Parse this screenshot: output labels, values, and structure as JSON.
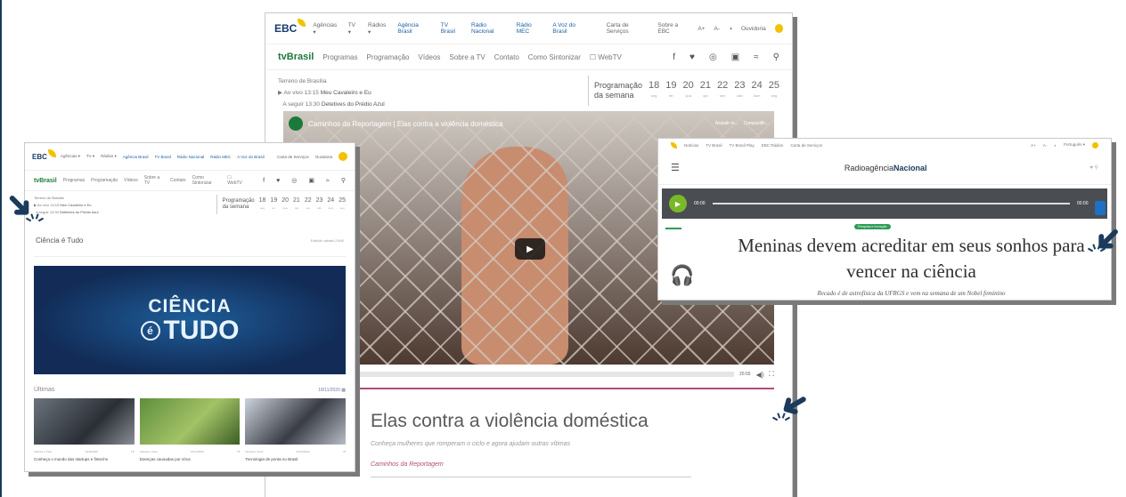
{
  "center": {
    "ebc": {
      "logo": "EBC",
      "links": [
        "Agências ▾",
        "TV ▾",
        "Rádios ▾"
      ],
      "brands": [
        "Agência Brasil",
        "TV Brasil",
        "Rádio Nacional",
        "Rádio MEC",
        "A Voz do Brasil"
      ],
      "right_links": [
        "Carta de Serviços",
        "Sobre a EBC",
        "A+",
        "A-",
        "◑",
        "Ouvidoria"
      ]
    },
    "tvbrasil": {
      "logo": "tvBrasil",
      "nav": [
        "Programas",
        "Programação",
        "Vídeos",
        "Sobre a TV",
        "Contato",
        "Como Sintonizar",
        "☐ WebTV"
      ],
      "social": [
        "f",
        "♥",
        "◎",
        "▣",
        "≈",
        "⚲"
      ]
    },
    "schedule": {
      "region": "Terreno de Brasília",
      "live_label": "Ao vivo",
      "live_time": "13:15",
      "live_show": "Meu Cavaleiro e Eu",
      "next_label": "A seguir",
      "next_time": "13:30",
      "next_show": "Detetives do Prédio Azul",
      "week_label_1": "Programação",
      "week_label_2": "da semana",
      "days": [
        {
          "n": "18",
          "d": "seg"
        },
        {
          "n": "19",
          "d": "ter"
        },
        {
          "n": "20",
          "d": "qua"
        },
        {
          "n": "21",
          "d": "qui"
        },
        {
          "n": "22",
          "d": "sex"
        },
        {
          "n": "23",
          "d": "sáb"
        },
        {
          "n": "24",
          "d": "dom"
        },
        {
          "n": "25",
          "d": "seg"
        }
      ]
    },
    "video": {
      "title": "Caminhos da Reportagem | Elas contra a violência doméstica",
      "watch_later": "Assistir m...",
      "share": "Compartilh...",
      "time": "26:55"
    },
    "article": {
      "title": "Elas contra a violência doméstica",
      "subtitle": "Conheça mulheres que romperam o ciclo e agora ajudam outras vítimas",
      "program": "Caminhos da Reportagem"
    }
  },
  "left": {
    "section_title": "Ciência é Tudo",
    "section_note": "Exibição: sábado 21h30",
    "banner_line1": "CIÊNCIA",
    "banner_e": "é",
    "banner_line2": "TUDO",
    "latest_label": "Últimas",
    "latest_date": "18/11/2020",
    "cards": [
      {
        "meta_a": "Ciência e Tudo",
        "meta_b": "14/11/2020",
        "title": "Conheça o mundo das startups e fintechs"
      },
      {
        "meta_a": "Ciência e Tudo",
        "meta_b": "07/11/2020",
        "title": "Doenças causadas por vírus"
      },
      {
        "meta_a": "Ciência e Tudo",
        "meta_b": "31/10/2020",
        "title": "Tecnologia de ponta no Brasil"
      }
    ]
  },
  "right": {
    "top_links": [
      "Notícias",
      "TV Brasil",
      "TV Brasil Play",
      "EBC Rádios",
      "Carta de Serviços"
    ],
    "top_right": [
      "A+",
      "A-",
      "◐",
      "Português ▾"
    ],
    "brand_a": "Radioagência",
    "brand_b": "Nacional",
    "player_start": "00:00",
    "player_end": "00:00",
    "tag": "Pesquisa e Inovação",
    "headline": "Meninas devem acreditar em seus sonhos para vencer na ciência",
    "dek": "Recado é de astrofísica da UFRGS e vem na semana de um Nobel feminino"
  },
  "colors": {
    "navy": "#1b3a5c",
    "magenta": "#b24b7e",
    "green": "#2e9b58",
    "yellow": "#f2c200"
  }
}
